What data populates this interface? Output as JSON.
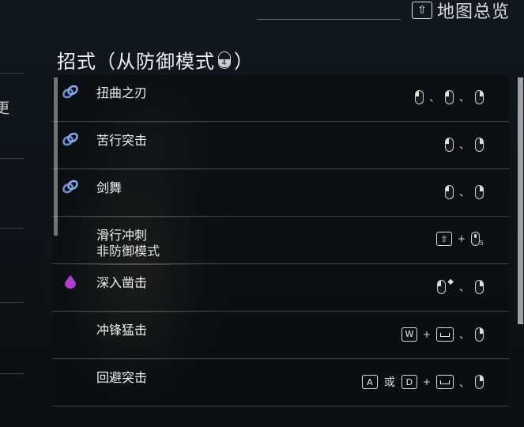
{
  "header": {
    "map_key": "⇧",
    "map_label": "地图总览"
  },
  "left_panel": {
    "partial_char": "更"
  },
  "title": {
    "prefix": "招式（从防御模式",
    "mouse_number": "4",
    "suffix": "）"
  },
  "moves": [
    {
      "name": "扭曲之刃",
      "sub": "",
      "icon": "chain-link-icon"
    },
    {
      "name": "苦行突击",
      "sub": "",
      "icon": "chain-link-icon"
    },
    {
      "name": "剑舞",
      "sub": "",
      "icon": "chain-link-icon"
    },
    {
      "name": "滑行冲刺",
      "sub": "非防御模式",
      "icon": ""
    },
    {
      "name": "深入凿击",
      "sub": "",
      "icon": "purple-drop-icon"
    },
    {
      "name": "冲锋猛击",
      "sub": "",
      "icon": ""
    },
    {
      "name": "回避突击",
      "sub": "",
      "icon": ""
    }
  ],
  "inputs": {
    "separator": "、",
    "plus": "+",
    "or": "或",
    "key_w": "W",
    "key_a": "A",
    "key_d": "D",
    "key_shift": "⇧",
    "mouse_number": "5",
    "star": "◆"
  },
  "colors": {
    "chain_link": "#6f8fe0",
    "purple_drop": "#b03fd0"
  }
}
